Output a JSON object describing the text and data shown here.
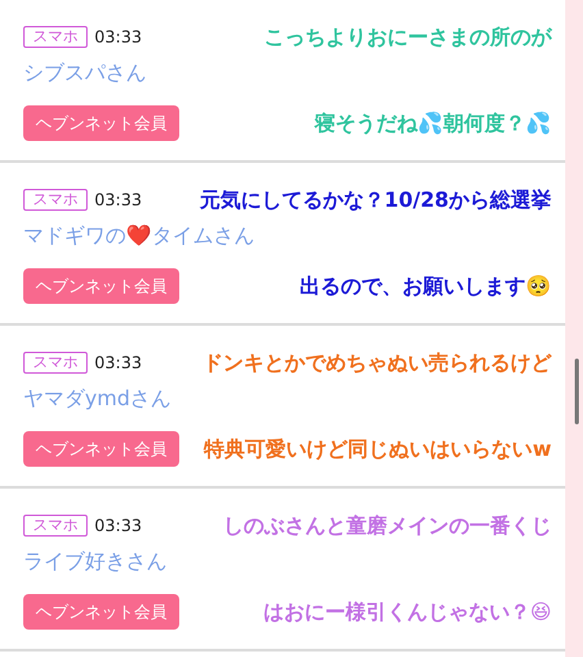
{
  "posts": [
    {
      "tag": "スマホ",
      "time": "03:33",
      "name": "シブスパさん",
      "button": "ヘブンネット会員",
      "caption": {
        "color": "#2fc49e",
        "lines": [
          "こっちよりおにーさまの所のが",
          "寝そうだね💦朝何度？💦"
        ]
      }
    },
    {
      "tag": "スマホ",
      "time": "03:33",
      "name": "マドギワの❤️タイムさん",
      "button": "ヘブンネット会員",
      "caption": {
        "color": "#1c1ad6",
        "lines": [
          "元気にしてるかな？10/28から総選挙",
          "出るので、お願いします🥺"
        ]
      }
    },
    {
      "tag": "スマホ",
      "time": "03:33",
      "name": "ヤマダymdさん",
      "button": "ヘブンネット会員",
      "caption": {
        "color": "#f0701e",
        "lines": [
          "ドンキとかでめちゃぬい売られるけど",
          "特典可愛いけど同じぬいはいらないw"
        ]
      }
    },
    {
      "tag": "スマホ",
      "time": "03:33",
      "name": "ライブ好きさん",
      "button": "ヘブンネット会員",
      "caption": {
        "color": "#c271e4",
        "lines": [
          "しのぶさんと童磨メインの一番くじ",
          "はおにー様引くんじゃない？😆"
        ]
      }
    }
  ]
}
